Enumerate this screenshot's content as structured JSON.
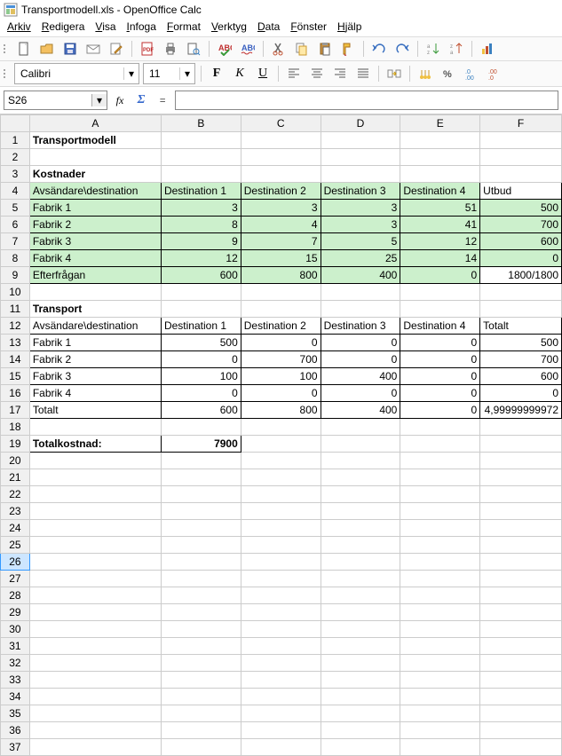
{
  "window": {
    "title": "Transportmodell.xls - OpenOffice Calc"
  },
  "menu": [
    "Arkiv",
    "Redigera",
    "Visa",
    "Infoga",
    "Format",
    "Verktyg",
    "Data",
    "Fönster",
    "Hjälp"
  ],
  "format_bar": {
    "font_name": "Calibri",
    "font_size": "11",
    "bold": "F",
    "italic": "K",
    "underline": "U"
  },
  "formula_bar": {
    "cell_ref": "S26",
    "fx": "fx",
    "sigma": "Σ",
    "equals": "=",
    "value": ""
  },
  "columns": [
    "",
    "A",
    "B",
    "C",
    "D",
    "E",
    "F"
  ],
  "rows": {
    "1": {
      "A": "Transportmodell"
    },
    "3": {
      "A": "Kostnader"
    },
    "4": {
      "A": "Avsändare\\destination",
      "B": "Destination 1",
      "C": "Destination 2",
      "D": "Destination 3",
      "E": "Destination 4",
      "F": "Utbud"
    },
    "5": {
      "A": "Fabrik 1",
      "B": "3",
      "C": "3",
      "D": "3",
      "E": "51",
      "F": "500"
    },
    "6": {
      "A": "Fabrik 2",
      "B": "8",
      "C": "4",
      "D": "3",
      "E": "41",
      "F": "700"
    },
    "7": {
      "A": "Fabrik 3",
      "B": "9",
      "C": "7",
      "D": "5",
      "E": "12",
      "F": "600"
    },
    "8": {
      "A": "Fabrik 4",
      "B": "12",
      "C": "15",
      "D": "25",
      "E": "14",
      "F": "0"
    },
    "9": {
      "A": "Efterfrågan",
      "B": "600",
      "C": "800",
      "D": "400",
      "E": "0",
      "F": "1800/1800"
    },
    "11": {
      "A": "Transport"
    },
    "12": {
      "A": "Avsändare\\destination",
      "B": "Destination 1",
      "C": "Destination 2",
      "D": "Destination 3",
      "E": "Destination 4",
      "F": "Totalt"
    },
    "13": {
      "A": "Fabrik 1",
      "B": "500",
      "C": "0",
      "D": "0",
      "E": "0",
      "F": "500"
    },
    "14": {
      "A": "Fabrik 2",
      "B": "0",
      "C": "700",
      "D": "0",
      "E": "0",
      "F": "700"
    },
    "15": {
      "A": "Fabrik 3",
      "B": "100",
      "C": "100",
      "D": "400",
      "E": "0",
      "F": "600"
    },
    "16": {
      "A": "Fabrik 4",
      "B": "0",
      "C": "0",
      "D": "0",
      "E": "0",
      "F": "0"
    },
    "17": {
      "A": "Totalt",
      "B": "600",
      "C": "800",
      "D": "400",
      "E": "0",
      "F": "4,99999999972"
    },
    "19": {
      "A": "Totalkostnad:",
      "B": "7900"
    }
  },
  "selected_row": 26,
  "visible_rows": 37
}
